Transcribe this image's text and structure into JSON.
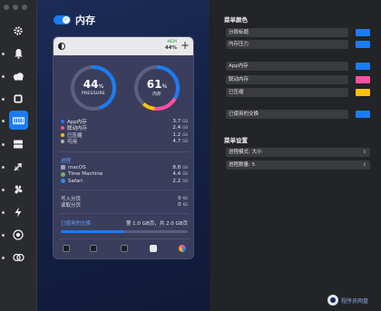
{
  "app": {
    "title": "内存"
  },
  "header_mini": {
    "label": "MEM",
    "value": "44%"
  },
  "gauges": [
    {
      "value": "44",
      "unit": "%",
      "label": "PRESSURE",
      "fraction": 0.44,
      "color": "#1a7cf5"
    },
    {
      "value": "61",
      "unit": "%",
      "label": "内存",
      "fraction": 0.61,
      "color": "#1a7cf5"
    }
  ],
  "memory_rows": [
    {
      "label": "App内存",
      "value": "3.7",
      "unit": "GB",
      "color": "#1a7cf5"
    },
    {
      "label": "联动内存",
      "value": "2.4",
      "unit": "GB",
      "color": "#ff4fa0"
    },
    {
      "label": "已压缩",
      "value": "1.2",
      "unit": "GB",
      "color": "#ffc107"
    },
    {
      "label": "可用",
      "value": "4.7",
      "unit": "GB",
      "color": "#b0b3c4"
    }
  ],
  "process_section": "进程",
  "processes": [
    {
      "label": "macOS",
      "value": "8.8",
      "unit": "GB",
      "icon": "macos-icon",
      "color": "#9aa0b5"
    },
    {
      "label": "Time Machine",
      "value": "4.4",
      "unit": "GB",
      "icon": "time-machine-icon",
      "color": "#6fb36a"
    },
    {
      "label": "Safari",
      "value": "2.2",
      "unit": "GB",
      "icon": "safari-icon",
      "color": "#2d8cf0"
    }
  ],
  "paging": [
    {
      "label": "写入分页",
      "value": "0",
      "unit": "KB"
    },
    {
      "label": "读取分页",
      "value": "0",
      "unit": "KB"
    }
  ],
  "swap": {
    "label": "已使用的交换",
    "value": "第 1.0 GB页，共 2.0 GB页",
    "fraction": 0.5
  },
  "settings": {
    "color_header": "菜单颜色",
    "color_rows_a": [
      {
        "label": "分段标题",
        "color": "#1a7cf5"
      },
      {
        "label": "内存压力",
        "color": "#1a7cf5"
      }
    ],
    "color_rows_b": [
      {
        "label": "App内存",
        "color": "#1a7cf5"
      },
      {
        "label": "联动内存",
        "color": "#ff4fa0"
      },
      {
        "label": "已压缩",
        "color": "#ffc107"
      }
    ],
    "color_rows_c": [
      {
        "label": "已使用的交换",
        "color": "#1a7cf5"
      }
    ],
    "menu_header": "菜单设置",
    "selects": [
      {
        "label": "进程模式: 大小"
      },
      {
        "label": "进程数量: 5"
      }
    ]
  },
  "watermark": "程序员网盘",
  "sidebar_icons": [
    "gear-icon",
    "bell-icon",
    "cloud-icon",
    "cpu-icon",
    "memory-icon",
    "disk-icon",
    "network-icon",
    "fan-icon",
    "battery-icon",
    "clock-icon",
    "bluetooth-icon"
  ]
}
